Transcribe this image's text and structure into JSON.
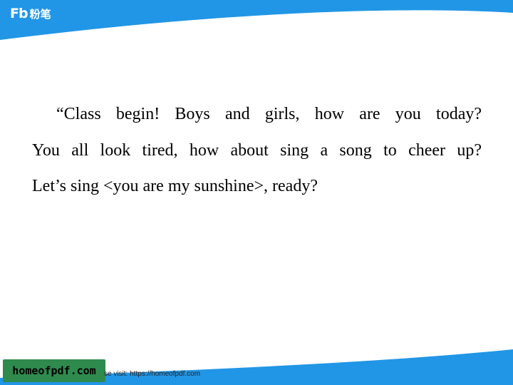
{
  "header": {
    "logo_mark": "Fb",
    "logo_text": "粉笔"
  },
  "content": {
    "lines": [
      "“Class begin! Boys and girls, how are you today?",
      "You all look tired, how about sing a song to cheer up?",
      "Let’s sing <you are my sunshine>, ready?"
    ]
  },
  "footer": {
    "watermark_label": "homeofpdf.com",
    "watermark_note": "se visit: https://homeofpdf.com"
  },
  "colors": {
    "brand_blue": "#2196e6",
    "watermark_green": "#2f8a4e"
  }
}
